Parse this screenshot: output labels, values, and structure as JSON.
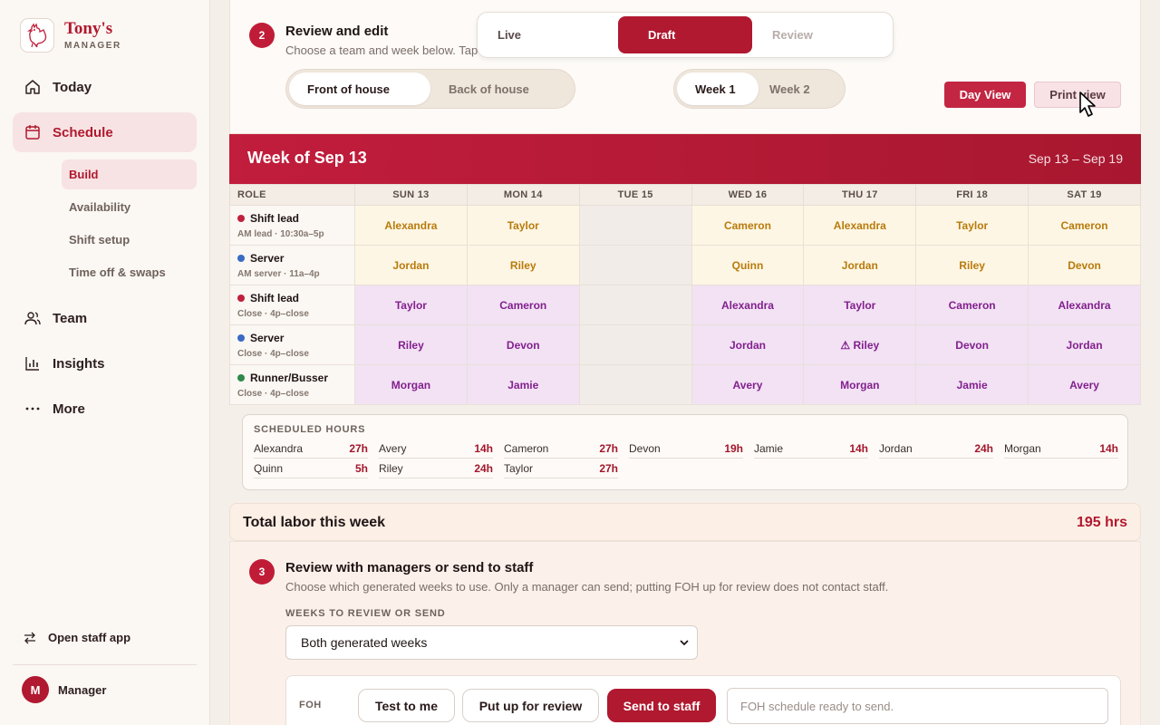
{
  "brand": {
    "name": "Tony's",
    "sub": "MANAGER"
  },
  "nav": {
    "today": "Today",
    "schedule": "Schedule",
    "sub_items": [
      "Build",
      "Availability",
      "Shift setup",
      "Time off & swaps"
    ],
    "team": "Team",
    "insights": "Insights",
    "more": "More"
  },
  "footer": {
    "open_staff": "Open staff app",
    "manager": "Manager",
    "avatar_initial": "M"
  },
  "status_tabs": [
    "Live",
    "Draft",
    "Review"
  ],
  "step2": {
    "num": "2",
    "title": "Review and edit",
    "desc": "Choose a team and week below. Tap a"
  },
  "team_toggle": [
    "Front of house",
    "Back of house"
  ],
  "week_toggle": [
    "Week 1",
    "Week 2"
  ],
  "view_buttons": {
    "day": "Day View",
    "print": "Print view"
  },
  "week": {
    "title": "Week of Sep 13",
    "range": "Sep 13 – Sep 19",
    "headers": [
      "ROLE",
      "SUN 13",
      "MON 14",
      "TUE 15",
      "WED 16",
      "THU 17",
      "FRI 18",
      "SAT 19"
    ],
    "rows": [
      {
        "role": "Shift lead",
        "sub": "AM lead · 10:30a–5p",
        "dot": "#c0203e",
        "kind": "am",
        "cells": [
          "Alexandra",
          "Taylor",
          "",
          "Cameron",
          "Alexandra",
          "Taylor",
          "Cameron"
        ]
      },
      {
        "role": "Server",
        "sub": "AM server · 11a–4p",
        "dot": "#3a6bc4",
        "kind": "am",
        "cells": [
          "Jordan",
          "Riley",
          "",
          "Quinn",
          "Jordan",
          "Riley",
          "Devon"
        ]
      },
      {
        "role": "Shift lead",
        "sub": "Close · 4p–close",
        "dot": "#c0203e",
        "kind": "pm",
        "cells": [
          "Taylor",
          "Cameron",
          "",
          "Alexandra",
          "Taylor",
          "Cameron",
          "Alexandra"
        ]
      },
      {
        "role": "Server",
        "sub": "Close · 4p–close",
        "dot": "#3a6bc4",
        "kind": "pm",
        "cells": [
          "Riley",
          "Devon",
          "",
          "Jordan",
          "⚠ Riley",
          "Devon",
          "Jordan"
        ]
      },
      {
        "role": "Runner/Busser",
        "sub": "Close · 4p–close",
        "dot": "#2e8a4a",
        "kind": "pm",
        "cells": [
          "Morgan",
          "Jamie",
          "",
          "Avery",
          "Morgan",
          "Jamie",
          "Avery"
        ]
      }
    ]
  },
  "hours": {
    "title": "SCHEDULED HOURS",
    "items": [
      {
        "name": "Alexandra",
        "hrs": "27h"
      },
      {
        "name": "Avery",
        "hrs": "14h"
      },
      {
        "name": "Cameron",
        "hrs": "27h"
      },
      {
        "name": "Devon",
        "hrs": "19h"
      },
      {
        "name": "Jamie",
        "hrs": "14h"
      },
      {
        "name": "Jordan",
        "hrs": "24h"
      },
      {
        "name": "Morgan",
        "hrs": "14h"
      },
      {
        "name": "Quinn",
        "hrs": "5h"
      },
      {
        "name": "Riley",
        "hrs": "24h"
      },
      {
        "name": "Taylor",
        "hrs": "27h"
      }
    ]
  },
  "total": {
    "label": "Total labor this week",
    "value": "195 hrs"
  },
  "step3": {
    "num": "3",
    "title": "Review with managers or send to staff",
    "desc": "Choose which generated weeks to use. Only a manager can send; putting FOH up for review does not contact staff.",
    "field_label": "WEEKS TO REVIEW OR SEND",
    "select_value": "Both generated weeks"
  },
  "foh": {
    "label": "FOH",
    "test": "Test to me",
    "review": "Put up for review",
    "send": "Send to staff",
    "placeholder": "FOH schedule ready to send."
  },
  "colors": {
    "accent": "#b0192f",
    "am_text": "#b87b0c",
    "pm_text": "#83208e"
  }
}
